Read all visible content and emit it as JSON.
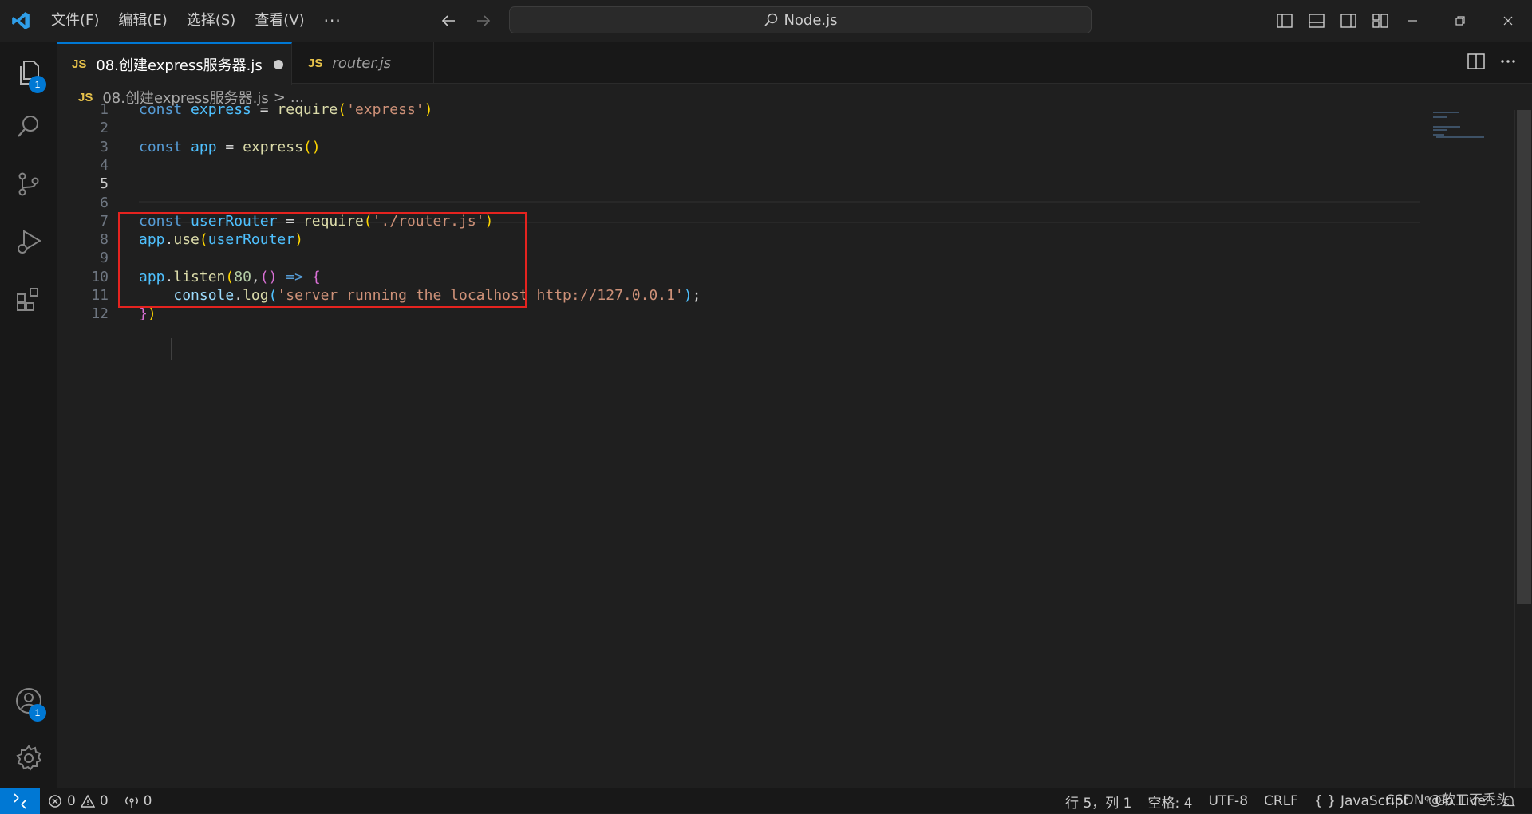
{
  "titlebar": {
    "menu": [
      "文件(F)",
      "编辑(E)",
      "选择(S)",
      "查看(V)"
    ],
    "more": "···",
    "search_text": "Node.js"
  },
  "activity": {
    "explorer_badge": "1",
    "accounts_badge": "1"
  },
  "tabs": [
    {
      "badge": "JS",
      "label": "08.创建express服务器.js"
    },
    {
      "badge": "JS",
      "label": "router.js"
    }
  ],
  "breadcrumb": {
    "badge": "JS",
    "file": "08.创建express服务器.js",
    "separator": ">",
    "rest": "..."
  },
  "editor": {
    "line_numbers": [
      "1",
      "2",
      "3",
      "4",
      "5",
      "6",
      "7",
      "8",
      "9",
      "10",
      "11",
      "12"
    ],
    "lines": [
      [
        {
          "t": "const ",
          "c": "kw"
        },
        {
          "t": "express",
          "c": "var"
        },
        {
          "t": " = ",
          "c": "plain"
        },
        {
          "t": "require",
          "c": "fn"
        },
        {
          "t": "(",
          "c": "br1"
        },
        {
          "t": "'express'",
          "c": "str"
        },
        {
          "t": ")",
          "c": "br1"
        }
      ],
      [],
      [
        {
          "t": "const ",
          "c": "kw"
        },
        {
          "t": "app",
          "c": "var"
        },
        {
          "t": " = ",
          "c": "plain"
        },
        {
          "t": "express",
          "c": "fn"
        },
        {
          "t": "()",
          "c": "br1"
        }
      ],
      [],
      [],
      [],
      [
        {
          "t": "const ",
          "c": "kw"
        },
        {
          "t": "userRouter",
          "c": "var"
        },
        {
          "t": " = ",
          "c": "plain"
        },
        {
          "t": "require",
          "c": "fn"
        },
        {
          "t": "(",
          "c": "br1"
        },
        {
          "t": "'./router.js'",
          "c": "str"
        },
        {
          "t": ")",
          "c": "br1"
        }
      ],
      [
        {
          "t": "app",
          "c": "var"
        },
        {
          "t": ".",
          "c": "plain"
        },
        {
          "t": "use",
          "c": "fn"
        },
        {
          "t": "(",
          "c": "br1"
        },
        {
          "t": "userRouter",
          "c": "var"
        },
        {
          "t": ")",
          "c": "br1"
        }
      ],
      [],
      [
        {
          "t": "app",
          "c": "var"
        },
        {
          "t": ".",
          "c": "plain"
        },
        {
          "t": "listen",
          "c": "fn"
        },
        {
          "t": "(",
          "c": "br1"
        },
        {
          "t": "80",
          "c": "num"
        },
        {
          "t": ",",
          "c": "plain"
        },
        {
          "t": "()",
          "c": "br2"
        },
        {
          "t": " => ",
          "c": "kw"
        },
        {
          "t": "{",
          "c": "br2"
        }
      ],
      [
        {
          "t": "    ",
          "c": "plain"
        },
        {
          "t": "console",
          "c": "prop"
        },
        {
          "t": ".",
          "c": "plain"
        },
        {
          "t": "log",
          "c": "fn"
        },
        {
          "t": "(",
          "c": "var"
        },
        {
          "t": "'server running the localhost ",
          "c": "str"
        },
        {
          "t": "http://127.0.0.1",
          "c": "str link"
        },
        {
          "t": "'",
          "c": "str"
        },
        {
          "t": ")",
          "c": "var"
        },
        {
          "t": ";",
          "c": "plain"
        }
      ],
      [
        {
          "t": "}",
          "c": "br2"
        },
        {
          "t": ")",
          "c": "br1"
        }
      ]
    ]
  },
  "statusbar": {
    "errors": "0",
    "warnings": "0",
    "ports": "0",
    "position": "行 5，列 1",
    "spaces": "空格: 4",
    "encoding": "UTF-8",
    "eol": "CRLF",
    "language": "JavaScript",
    "golive": "Go Live"
  },
  "watermark": "CSDN @软工不秃头",
  "colors": {
    "accent": "#0078d4",
    "highlight_box": "#e5231f",
    "js_badge": "#e8c34b"
  }
}
